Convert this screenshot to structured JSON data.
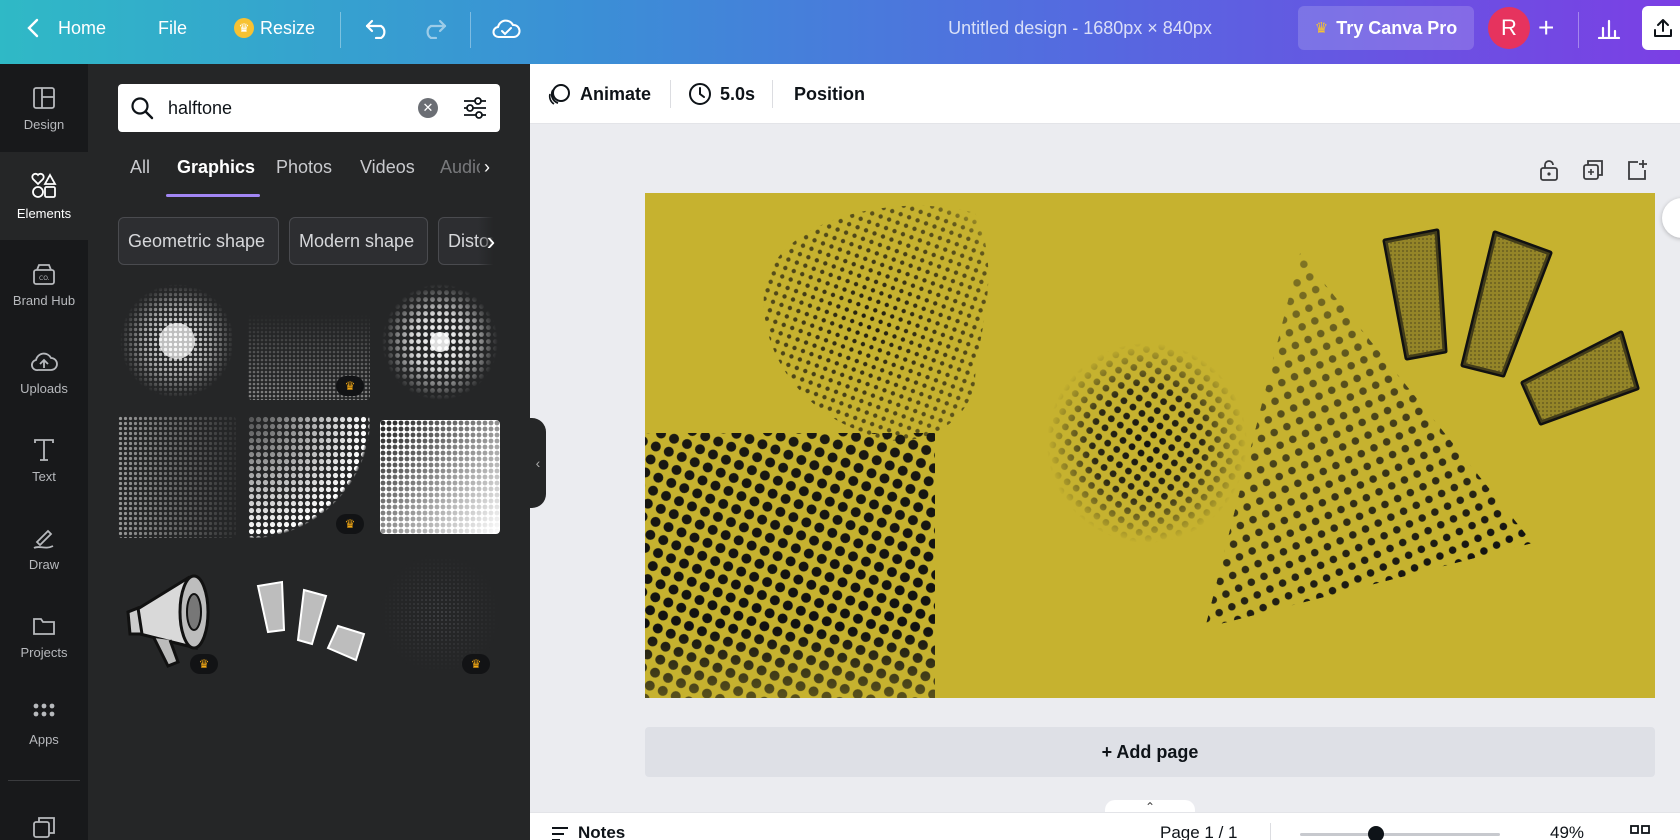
{
  "topbar": {
    "home_label": "Home",
    "file_label": "File",
    "resize_label": "Resize",
    "doc_title": "Untitled design - 1680px × 840px",
    "try_pro_label": "Try Canva Pro",
    "avatar_letter": "R"
  },
  "rail": {
    "items": [
      {
        "label": "Design",
        "icon": "layout-icon"
      },
      {
        "label": "Elements",
        "icon": "elements-icon"
      },
      {
        "label": "Brand Hub",
        "icon": "brand-hub-icon"
      },
      {
        "label": "Uploads",
        "icon": "cloud-upload-icon"
      },
      {
        "label": "Text",
        "icon": "text-icon"
      },
      {
        "label": "Draw",
        "icon": "pen-icon"
      },
      {
        "label": "Projects",
        "icon": "folder-icon"
      },
      {
        "label": "Apps",
        "icon": "apps-grid-icon"
      }
    ],
    "active": "Elements"
  },
  "panel": {
    "search_value": "halftone",
    "tabs": [
      "All",
      "Graphics",
      "Photos",
      "Videos",
      "Audio"
    ],
    "active_tab": "Graphics",
    "chips": [
      "Geometric shape",
      "Modern shape",
      "Distorted"
    ]
  },
  "editor": {
    "animate_label": "Animate",
    "duration_label": "5.0s",
    "position_label": "Position",
    "add_page_label": "+ Add page",
    "notes_label": "Notes",
    "page_indicator": "Page 1 / 1",
    "zoom_label": "49%"
  },
  "colors": {
    "canvas_bg": "#c6b22f",
    "accent_tab": "#a286f4",
    "pro_crown": "#f2a814",
    "avatar_bg": "#e6335e"
  }
}
